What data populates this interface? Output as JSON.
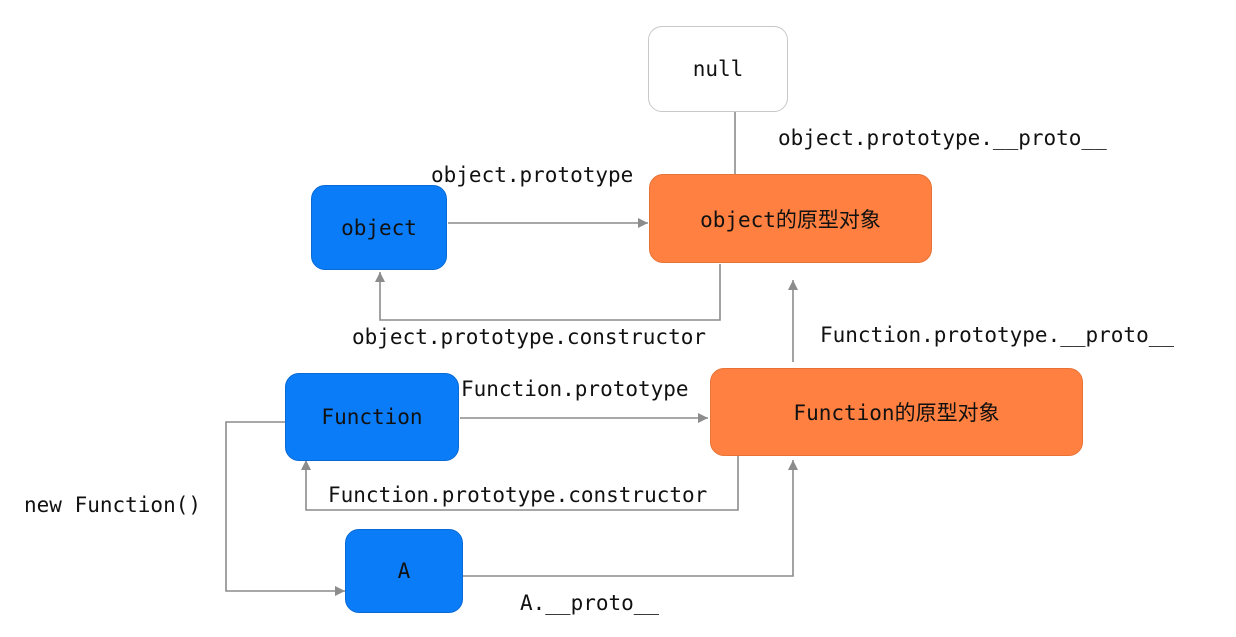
{
  "nodes": {
    "null": "null",
    "object": "object",
    "object_proto": "object的原型对象",
    "function": "Function",
    "function_proto": "Function的原型对象",
    "a": "A"
  },
  "edges": {
    "object_prototype": "object.prototype",
    "object_prototype_proto": "object.prototype.__proto__",
    "object_prototype_constructor": "object.prototype.constructor",
    "function_prototype": "Function.prototype",
    "function_prototype_proto": "Function.prototype.__proto__",
    "function_prototype_constructor": "Function.prototype.constructor",
    "new_function": "new Function()",
    "a_proto": "A.__proto__"
  },
  "colors": {
    "blue_node": "#0a7cf7",
    "orange_node": "#ff8040",
    "arrow": "#8c8c8c"
  }
}
